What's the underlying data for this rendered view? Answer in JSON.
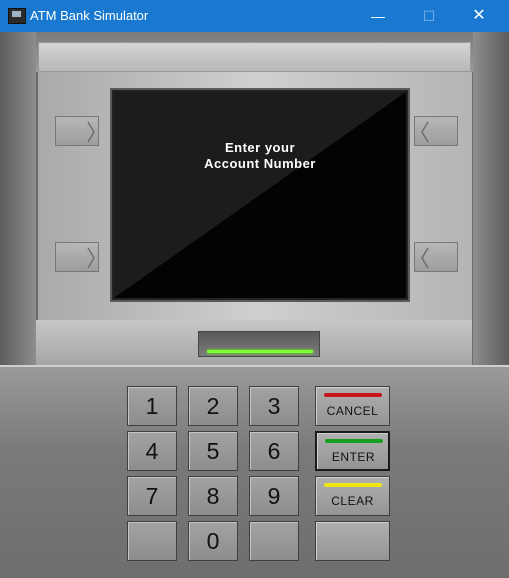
{
  "window": {
    "title": "ATM Bank Simulator",
    "minimize_glyph": "—",
    "maximize_glyph": "☐",
    "close_glyph": "✕"
  },
  "screen": {
    "line1": "Enter your",
    "line2": "Account Number"
  },
  "keypad": {
    "keys": [
      "1",
      "2",
      "3",
      "4",
      "5",
      "6",
      "7",
      "8",
      "9",
      "",
      "0",
      ""
    ]
  },
  "function_keys": {
    "cancel": {
      "label": "CANCEL",
      "color": "#c8141e"
    },
    "enter": {
      "label": "ENTER",
      "color": "#14a01e"
    },
    "clear": {
      "label": "CLEAR",
      "color": "#f0e614"
    },
    "blank": {
      "label": ""
    }
  },
  "colors": {
    "titlebar": "#1979d0",
    "card_light": "#7cff2e"
  }
}
